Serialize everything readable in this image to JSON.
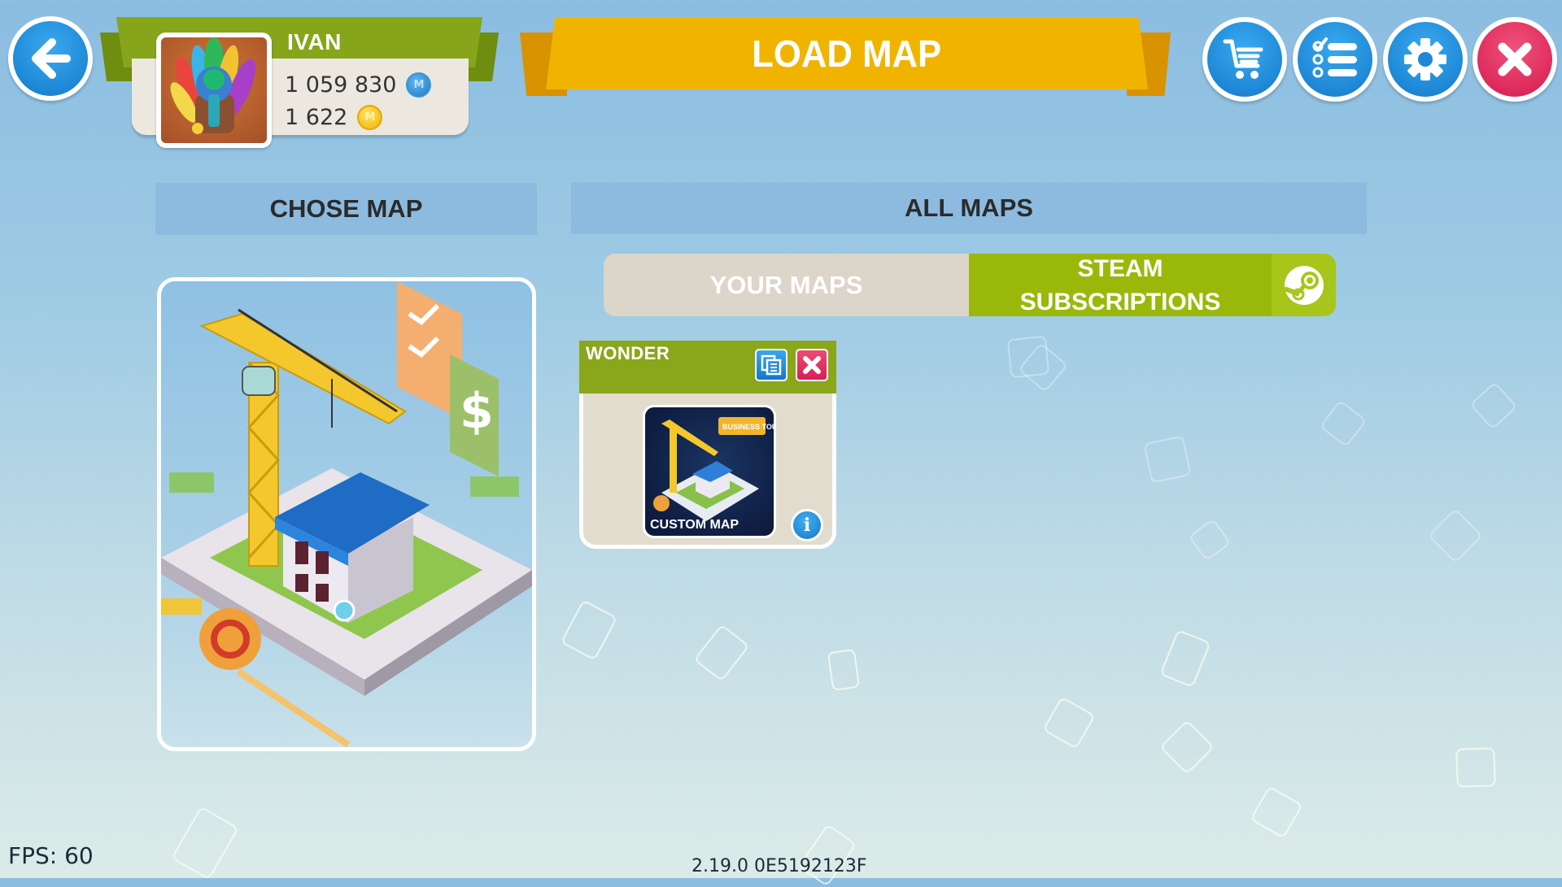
{
  "header": {
    "title": "LOAD MAP",
    "back_button": "back-arrow",
    "player": {
      "name": "IVAN",
      "money": "1 059 830",
      "money_icon": "blue-m-coin",
      "coins": "1 622",
      "coins_icon": "gold-coin"
    },
    "actions": [
      {
        "name": "shop",
        "icon": "cart-icon"
      },
      {
        "name": "quests",
        "icon": "checklist-icon"
      },
      {
        "name": "settings",
        "icon": "gear-icon"
      },
      {
        "name": "close",
        "icon": "close-icon"
      }
    ]
  },
  "left_panel": {
    "title": "CHOSE MAP",
    "preview_alt": "Custom map editor illustration"
  },
  "right_panel": {
    "title": "ALL MAPS",
    "tabs": [
      {
        "label": "YOUR MAPS",
        "active": false
      },
      {
        "label_line1": "STEAM",
        "label_line2": "SUBSCRIPTIONS",
        "active": true,
        "icon": "steam-icon"
      }
    ],
    "maps": [
      {
        "name": "WONDER",
        "thumbnail_label": "CUSTOM MAP",
        "thumbnail_badge": "BUSINESS TOUR"
      }
    ]
  },
  "footer": {
    "fps": "FPS: 60",
    "version": "2.19.0 0E5192123F"
  },
  "colors": {
    "banner": "#f0b400",
    "ribbon_green": "#86a51b",
    "tab_active": "#9ab80a",
    "tab_inactive": "#dcd5c9",
    "button_blue": "#1e88d6",
    "button_red": "#de2a5c"
  }
}
